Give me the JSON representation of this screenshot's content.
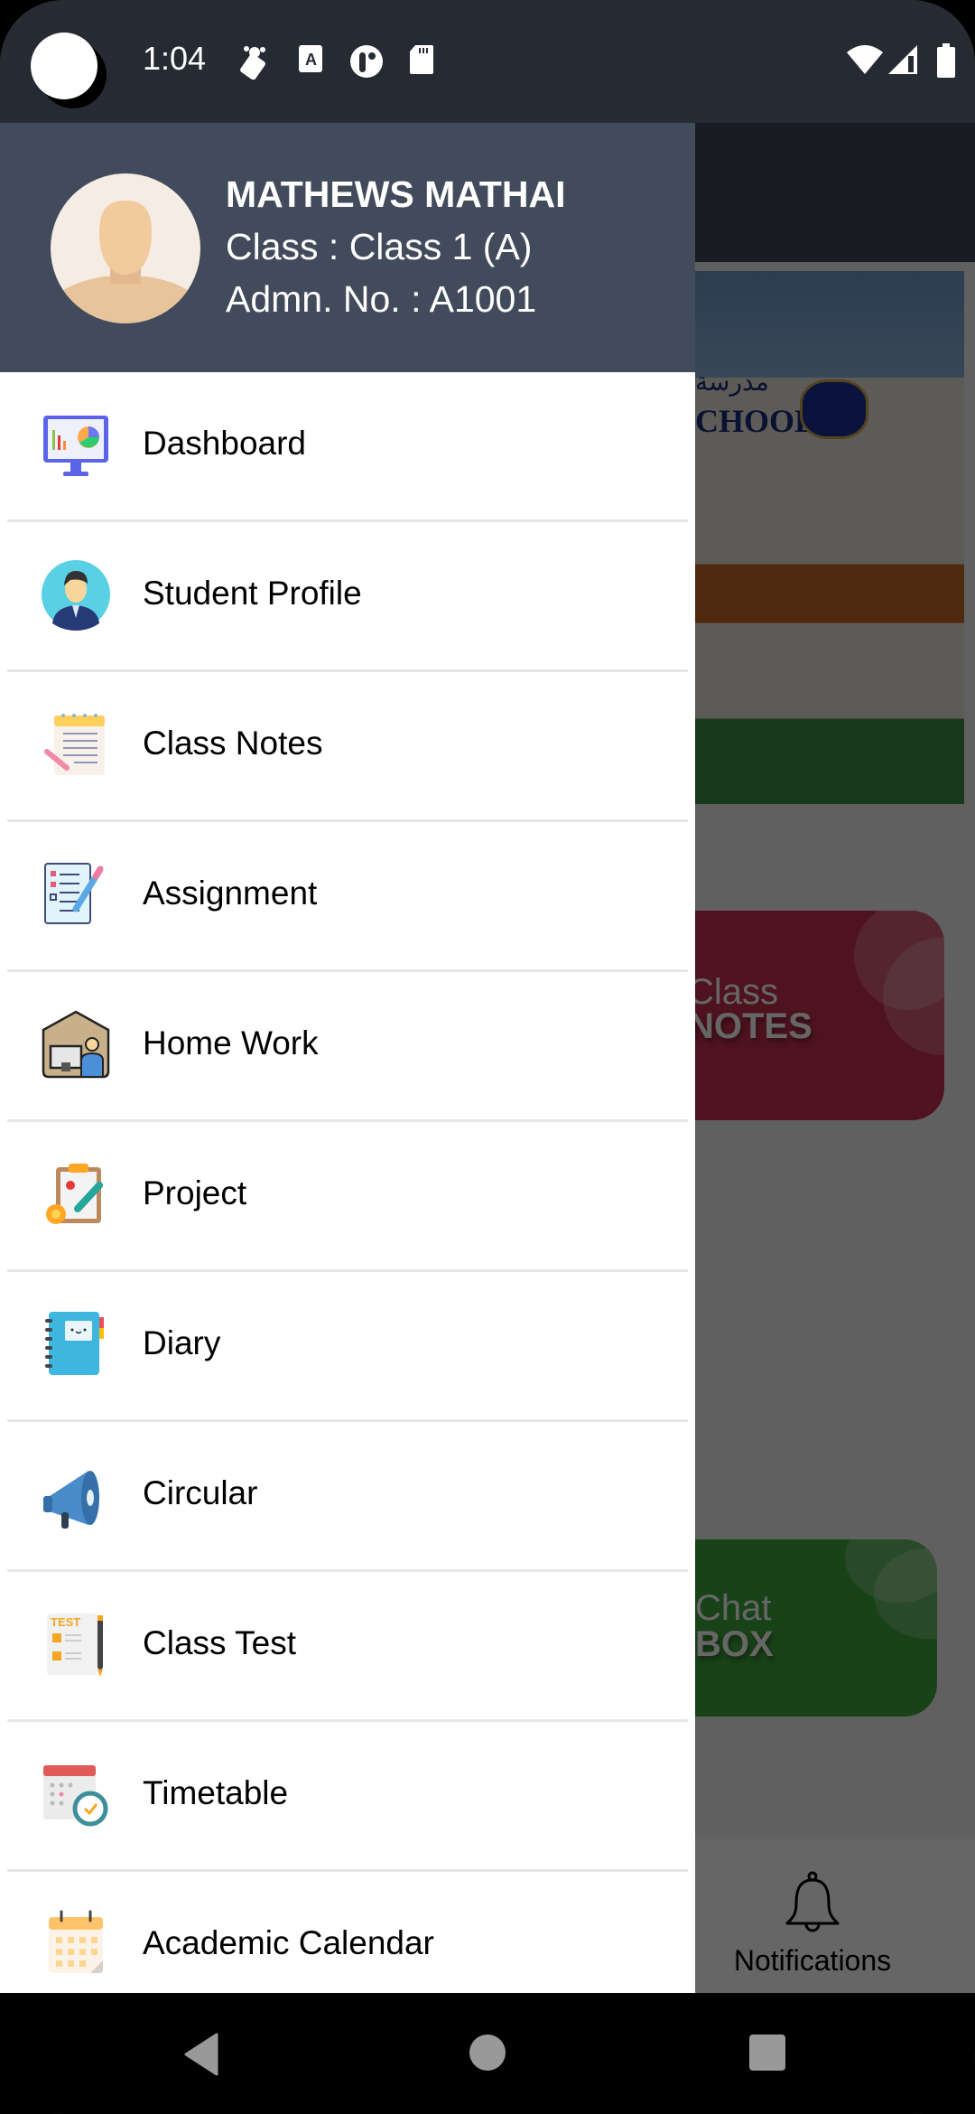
{
  "status_bar": {
    "time": "1:04",
    "left_icons": [
      "camera-cutout",
      "location-app-icon",
      "text-a-icon",
      "circle-app-icon",
      "sd-card-icon"
    ],
    "right_icons": [
      "wifi-icon",
      "signal-icon",
      "battery-icon"
    ]
  },
  "drawer": {
    "user": {
      "name": "MATHEWS MATHAI",
      "class_line": "Class : Class 1 (A)",
      "admission_line": "Admn. No. : A1001",
      "avatar": "default-avatar"
    },
    "items": [
      {
        "label": "Dashboard",
        "icon": "dashboard-icon"
      },
      {
        "label": "Student Profile",
        "icon": "student-profile-icon"
      },
      {
        "label": "Class Notes",
        "icon": "class-notes-icon"
      },
      {
        "label": "Assignment",
        "icon": "assignment-icon"
      },
      {
        "label": "Home Work",
        "icon": "home-work-icon"
      },
      {
        "label": "Project",
        "icon": "project-icon"
      },
      {
        "label": "Diary",
        "icon": "diary-icon"
      },
      {
        "label": "Circular",
        "icon": "megaphone-icon"
      },
      {
        "label": "Class Test",
        "icon": "class-test-icon"
      },
      {
        "label": "Timetable",
        "icon": "timetable-icon"
      },
      {
        "label": "Academic Calendar",
        "icon": "calendar-icon"
      }
    ]
  },
  "background": {
    "banner_text": "CHOOL",
    "banner_arabic": "مدرسة",
    "cards": [
      {
        "line1": "Class",
        "line2": "NOTES",
        "color": "#c5304f"
      },
      {
        "line1": "Chat",
        "line2": "BOX",
        "color": "#3ea63e"
      }
    ],
    "bottom_nav": {
      "notifications_label": "Notifications"
    }
  },
  "colors": {
    "drawer_header": "#424b5b",
    "status_bar": "#262a33",
    "separator": "#e6e6e6"
  }
}
